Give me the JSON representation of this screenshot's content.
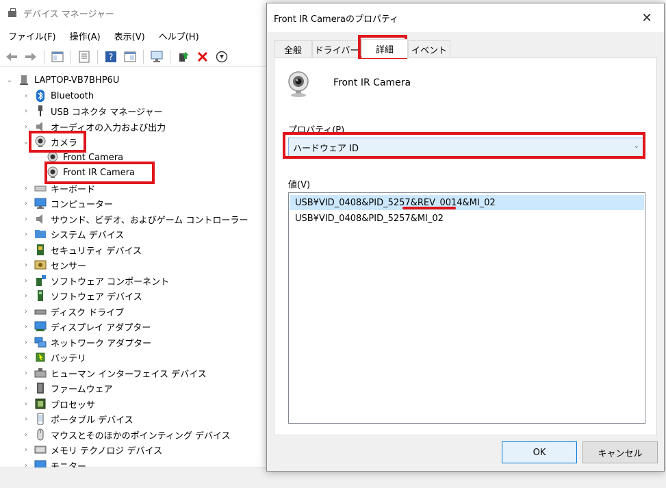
{
  "device_manager": {
    "title": "デバイス マネージャー",
    "menu": [
      "ファイル(F)",
      "操作(A)",
      "表示(V)",
      "ヘルプ(H)"
    ],
    "tree": {
      "root": "LAPTOP-VB7BHP6U",
      "items": [
        {
          "label": "Bluetooth",
          "icon": "bluetooth-icon",
          "expanded": false
        },
        {
          "label": "USB コネクタ マネージャー",
          "icon": "usb-connector-icon",
          "expanded": false
        },
        {
          "label": "オーディオの入力および出力",
          "icon": "speaker-icon",
          "expanded": false
        },
        {
          "label": "カメラ",
          "icon": "webcam-icon",
          "expanded": true
        },
        {
          "label": "Front Camera",
          "icon": "webcam-icon",
          "child": true
        },
        {
          "label": "Front IR Camera",
          "icon": "webcam-icon",
          "child": true
        },
        {
          "label": "キーボード",
          "icon": "keyboard-icon",
          "expanded": false
        },
        {
          "label": "コンピューター",
          "icon": "monitor-icon",
          "expanded": false
        },
        {
          "label": "サウンド、ビデオ、およびゲーム コントローラー",
          "icon": "speaker-icon",
          "expanded": false
        },
        {
          "label": "システム デバイス",
          "icon": "folder-icon",
          "expanded": false
        },
        {
          "label": "セキュリティ デバイス",
          "icon": "security-chip-icon",
          "expanded": false
        },
        {
          "label": "センサー",
          "icon": "sensor-icon",
          "expanded": false
        },
        {
          "label": "ソフトウェア コンポーネント",
          "icon": "component-icon",
          "expanded": false
        },
        {
          "label": "ソフトウェア デバイス",
          "icon": "software-device-icon",
          "expanded": false
        },
        {
          "label": "ディスク ドライブ",
          "icon": "disk-drive-icon",
          "expanded": false
        },
        {
          "label": "ディスプレイ アダプター",
          "icon": "display-adapter-icon",
          "expanded": false
        },
        {
          "label": "ネットワーク アダプター",
          "icon": "network-icon",
          "expanded": false
        },
        {
          "label": "バッテリ",
          "icon": "battery-icon",
          "expanded": false
        },
        {
          "label": "ヒューマン インターフェイス デバイス",
          "icon": "hid-icon",
          "expanded": false
        },
        {
          "label": "ファームウェア",
          "icon": "firmware-icon",
          "expanded": false
        },
        {
          "label": "プロセッサ",
          "icon": "processor-icon",
          "expanded": false
        },
        {
          "label": "ポータブル デバイス",
          "icon": "portable-device-icon",
          "expanded": false
        },
        {
          "label": "マウスとそのほかのポインティング デバイス",
          "icon": "mouse-icon",
          "expanded": false
        },
        {
          "label": "メモリ テクノロジ デバイス",
          "icon": "memory-icon",
          "expanded": false
        },
        {
          "label": "モニター",
          "icon": "monitor-icon",
          "expanded": false
        }
      ]
    }
  },
  "dialog": {
    "title": "Front IR Cameraのプロパティ",
    "tabs": [
      "全般",
      "ドライバー",
      "詳細",
      "イベント"
    ],
    "active_tab": "詳細",
    "device_name": "Front IR Camera",
    "property_label": "プロパティ(P)",
    "property_selected": "ハードウェア ID",
    "value_label": "値(V)",
    "values": [
      "USB¥VID_0408&PID_5257&REV_0014&MI_02",
      "USB¥VID_0408&PID_5257&MI_02"
    ],
    "ok_label": "OK",
    "cancel_label": "キャンセル"
  },
  "colors": {
    "highlight": "#e0151b",
    "selection": "#cce8ff",
    "accent": "#0078d7"
  }
}
